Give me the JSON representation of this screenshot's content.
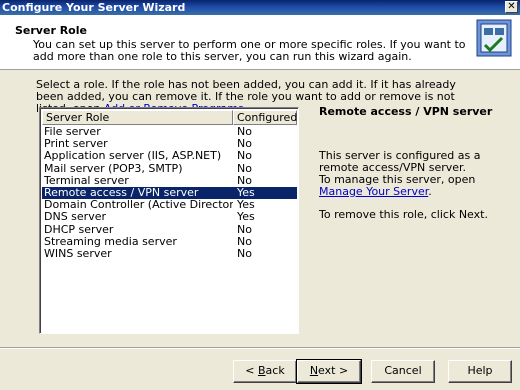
{
  "window": {
    "title": "Configure Your Server Wizard",
    "close_glyph": "✕"
  },
  "header": {
    "title": "Server Role",
    "description": "You can set up this server to perform one or more specific roles. If you want to add more than one role to this server, you can run this wizard again."
  },
  "instructions": {
    "text_before_link": "Select a role. If the role has not been added, you can add it. If it has already been added, you can remove it. If the role you want to add or remove is not listed, open ",
    "link": "Add or Remove Programs",
    "text_after_link": "."
  },
  "role_list": {
    "columns": [
      "Server Role",
      "Configured"
    ],
    "rows": [
      {
        "role": "File server",
        "configured": "No"
      },
      {
        "role": "Print server",
        "configured": "No"
      },
      {
        "role": "Application server (IIS, ASP.NET)",
        "configured": "No"
      },
      {
        "role": "Mail server (POP3, SMTP)",
        "configured": "No"
      },
      {
        "role": "Terminal server",
        "configured": "No"
      },
      {
        "role": "Remote access / VPN server",
        "configured": "Yes"
      },
      {
        "role": "Domain Controller (Active Directory)",
        "configured": "Yes"
      },
      {
        "role": "DNS server",
        "configured": "Yes"
      },
      {
        "role": "DHCP server",
        "configured": "No"
      },
      {
        "role": "Streaming media server",
        "configured": "No"
      },
      {
        "role": "WINS server",
        "configured": "No"
      }
    ],
    "selected_index": 5
  },
  "detail": {
    "title": "Remote access / VPN server",
    "line1": "This server is configured as a remote access/VPN server.",
    "line2_before_link": "To manage this server, open ",
    "line2_link": "Manage Your Server",
    "line2_after_link": ".",
    "remove_text": "To remove this role, click Next."
  },
  "buttons": {
    "back": {
      "prefix": "< ",
      "accel": "B",
      "rest": "ack"
    },
    "next": {
      "prefix": "",
      "accel": "N",
      "rest": "ext >"
    },
    "cancel": "Cancel",
    "help": "Help"
  },
  "colors": {
    "titlebar": "#0a246a",
    "selection": "#0a246a",
    "dialog_bg": "#ece9d8",
    "link": "#0000cc"
  }
}
